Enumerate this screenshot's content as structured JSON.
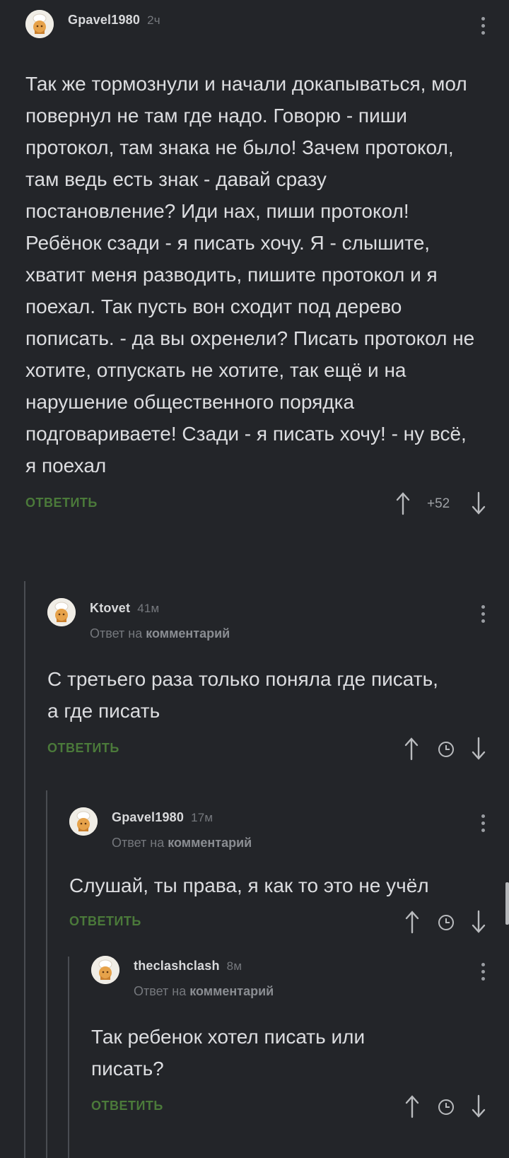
{
  "comments": [
    {
      "author": "Gpavel1980",
      "time": "2ч",
      "text": "Так же тормознули и начали докапываться, мол повернул не там где надо. Говорю - пиши протокол, там знака не было! Зачем протокол, там ведь есть знак - давай сразу постановление? Иди нах, пиши протокол! Ребёнок сзади - я писать хочу. Я - слышите, хватит меня разводить, пишите протокол и я поехал. Так пусть вон сходит под дерево пописать. - да вы охренели? Писать протокол не хотите, отпускать не хотите, так ещё и на нарушение общественного порядка подговариваете! Сзади - я писать хочу! - ну всё, я поехал",
      "reply_label": "ОТВЕТИТЬ",
      "rating": "+52"
    },
    {
      "author": "Ktovet",
      "time": "41м",
      "reply_prefix": "Ответ на",
      "reply_target": "комментарий",
      "text": "С третьего раза только поняла где писать, а где писать",
      "reply_label": "ОТВЕТИТЬ"
    },
    {
      "author": "Gpavel1980",
      "time": "17м",
      "reply_prefix": "Ответ на",
      "reply_target": "комментарий",
      "text": "Слушай, ты права, я как то это не учёл",
      "reply_label": "ОТВЕТИТЬ"
    },
    {
      "author": "theclashclash",
      "time": "8м",
      "reply_prefix": "Ответ на",
      "reply_target": "комментарий",
      "text": "Так ребенок хотел писать или писать?",
      "reply_label": "ОТВЕТИТЬ"
    }
  ],
  "icons": {
    "avatar": "chef-avatar-icon",
    "upvote": "arrow-up-icon",
    "downvote": "arrow-down-icon",
    "rating_hidden": "clock-icon",
    "menu": "more-vertical-icon"
  },
  "colors": {
    "background": "#232529",
    "reply_button": "#4b7a3a",
    "text": "#dcdde0",
    "muted": "#75787d"
  }
}
